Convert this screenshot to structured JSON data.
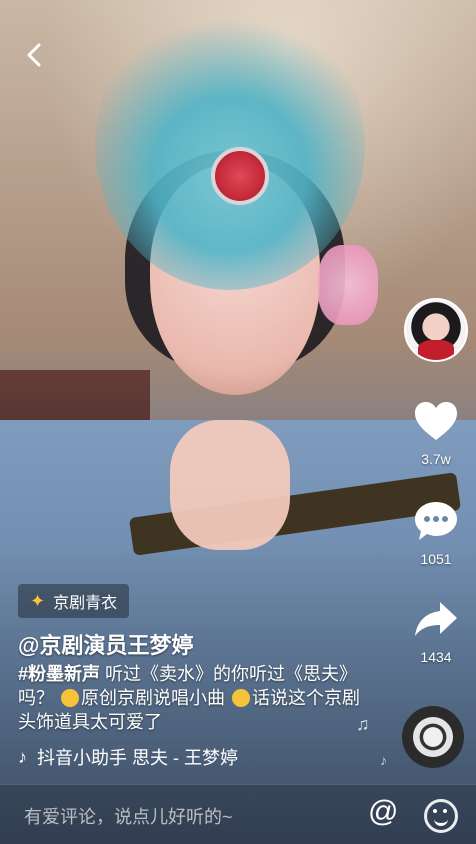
{
  "video": {
    "tag": "京剧青衣",
    "author": "@京剧演员王梦婷",
    "caption_hashtag": "#粉墨新声",
    "caption_part1": " 听过《卖水》的你听过《思夫》吗？",
    "caption_part2": "原创京剧说唱小曲",
    "caption_part3": "话说这个京剧头饰道具太可爱了",
    "music_label": "抖音小助手    思夫 - 王梦婷"
  },
  "side": {
    "likes": "3.7w",
    "comments": "1051",
    "shares": "1434"
  },
  "bottom": {
    "comment_placeholder": "有爱评论，说点儿好听的~",
    "at_symbol": "@"
  },
  "icons": {
    "back": "chevron-left-icon",
    "like": "heart-icon",
    "comment": "comment-bubble-icon",
    "share": "share-arrow-icon",
    "tag": "sparkle-icon",
    "music": "tiktok-note-icon",
    "emoji": "smile-icon"
  }
}
